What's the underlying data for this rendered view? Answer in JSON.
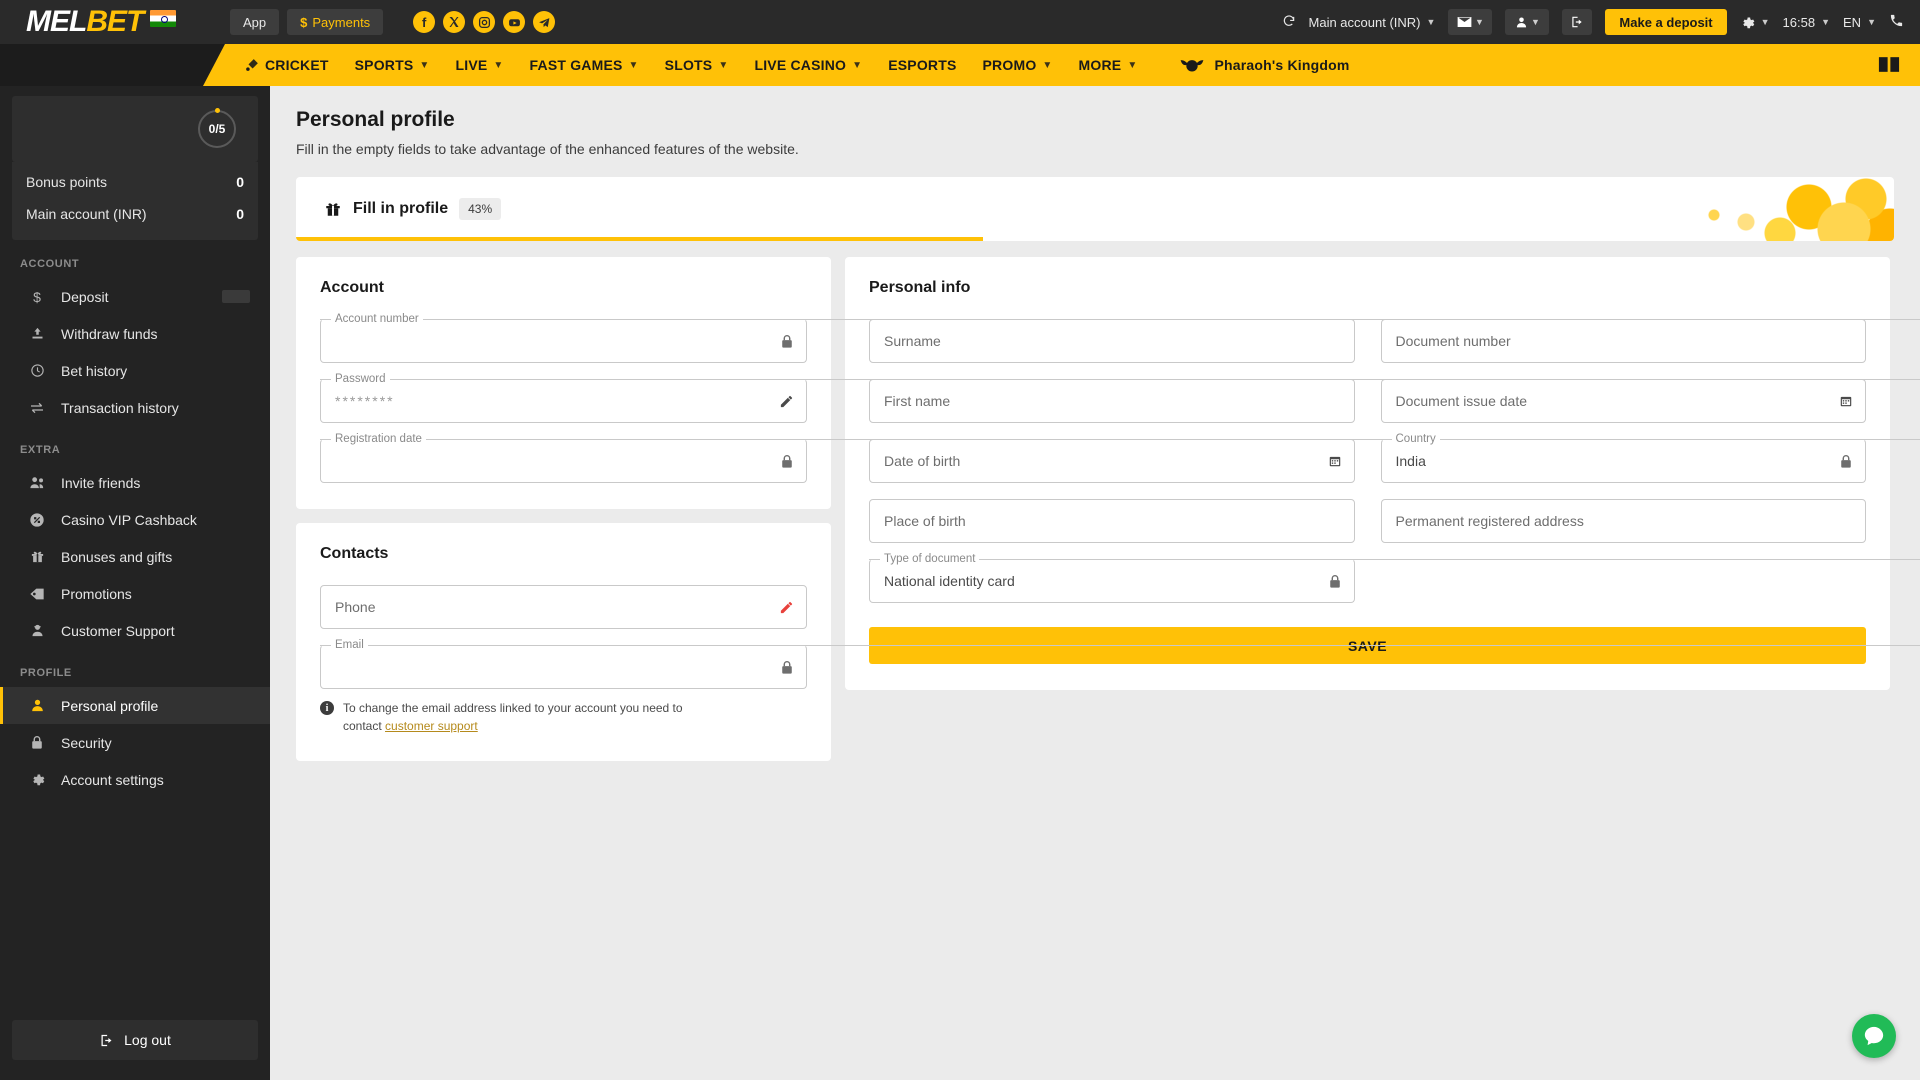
{
  "topbar": {
    "logo": {
      "part1": "MEL",
      "part2": "BET",
      "flag": "india-flag"
    },
    "app_label": "App",
    "payments_label": "Payments",
    "socials": [
      "facebook-icon",
      "x-twitter-icon",
      "instagram-icon",
      "youtube-icon",
      "telegram-icon"
    ],
    "account_label": "Main account (INR)",
    "deposit_label": "Make a deposit",
    "time": "16:58",
    "language": "EN",
    "icons": {
      "refresh": "refresh-icon",
      "mail": "mail-icon",
      "user": "user-icon",
      "logout": "logout-icon",
      "settings": "gear-icon",
      "phone": "phone-icon"
    }
  },
  "nav": {
    "items": [
      {
        "label": "CRICKET",
        "caret": false,
        "icon": "cricket-icon"
      },
      {
        "label": "SPORTS",
        "caret": true
      },
      {
        "label": "LIVE",
        "caret": true
      },
      {
        "label": "FAST GAMES",
        "caret": true
      },
      {
        "label": "SLOTS",
        "caret": true
      },
      {
        "label": "LIVE CASINO",
        "caret": true
      },
      {
        "label": "ESPORTS",
        "caret": false
      },
      {
        "label": "PROMO",
        "caret": true
      },
      {
        "label": "MORE",
        "caret": true
      }
    ],
    "promo": {
      "label": "Pharaoh's Kingdom",
      "icon": "pharaoh-icon"
    },
    "book_icon": "book-icon"
  },
  "sidebar": {
    "ring_value": "0/5",
    "balances": [
      {
        "label": "Bonus points",
        "value": "0"
      },
      {
        "label": "Main account (INR)",
        "value": "0"
      }
    ],
    "sections": [
      {
        "label": "ACCOUNT",
        "items": [
          {
            "label": "Deposit",
            "icon": "dollar-icon",
            "active": false,
            "badge": true
          },
          {
            "label": "Withdraw funds",
            "icon": "withdraw-icon",
            "active": false
          },
          {
            "label": "Bet history",
            "icon": "clock-icon",
            "active": false
          },
          {
            "label": "Transaction history",
            "icon": "transfer-icon",
            "active": false
          }
        ]
      },
      {
        "label": "EXTRA",
        "items": [
          {
            "label": "Invite friends",
            "icon": "people-icon",
            "active": false
          },
          {
            "label": "Casino VIP Cashback",
            "icon": "percent-icon",
            "active": false
          },
          {
            "label": "Bonuses and gifts",
            "icon": "gift-icon",
            "active": false
          },
          {
            "label": "Promotions",
            "icon": "tag-icon",
            "active": false
          },
          {
            "label": "Customer Support",
            "icon": "support-icon",
            "active": false
          }
        ]
      },
      {
        "label": "PROFILE",
        "items": [
          {
            "label": "Personal profile",
            "icon": "person-icon",
            "active": true
          },
          {
            "label": "Security",
            "icon": "lock-icon",
            "active": false
          },
          {
            "label": "Account settings",
            "icon": "gear-icon",
            "active": false
          }
        ]
      }
    ],
    "logout_label": "Log out",
    "logout_icon": "logout-icon"
  },
  "page": {
    "title": "Personal profile",
    "subtitle": "Fill in the empty fields to take advantage of the enhanced features of the website."
  },
  "banner": {
    "icon": "gift-icon",
    "title": "Fill in profile",
    "percent_label": "43%",
    "progress_percent": 43
  },
  "account_card": {
    "title": "Account",
    "fields": [
      {
        "label": "Account number",
        "value": "",
        "type": "floating",
        "icon": "lock-icon"
      },
      {
        "label": "Password",
        "value": "********",
        "type": "floating",
        "icon": "pencil-icon"
      },
      {
        "label": "Registration date",
        "value": "",
        "type": "floating",
        "icon": "lock-icon"
      }
    ]
  },
  "contacts_card": {
    "title": "Contacts",
    "fields": [
      {
        "label": "Phone",
        "value": "",
        "type": "placeholder",
        "icon": "pencil-icon-red"
      },
      {
        "label": "Email",
        "value": "",
        "type": "floating",
        "icon": "lock-icon"
      }
    ],
    "note_text": "To change the email address linked to your account you need to contact ",
    "note_link": "customer support"
  },
  "personal_info": {
    "title": "Personal info",
    "left_fields": [
      {
        "label": "Surname",
        "value": "",
        "type": "placeholder",
        "icon": ""
      },
      {
        "label": "First name",
        "value": "",
        "type": "placeholder",
        "icon": ""
      },
      {
        "label": "Date of birth",
        "value": "",
        "type": "placeholder",
        "icon": "calendar-icon"
      },
      {
        "label": "Place of birth",
        "value": "",
        "type": "placeholder",
        "icon": ""
      },
      {
        "label": "Type of document",
        "value": "National identity card",
        "type": "floating",
        "icon": "lock-icon"
      }
    ],
    "right_fields": [
      {
        "label": "Document number",
        "value": "",
        "type": "placeholder",
        "icon": ""
      },
      {
        "label": "Document issue date",
        "value": "",
        "type": "placeholder",
        "icon": "calendar-icon"
      },
      {
        "label": "Country",
        "value": "India",
        "type": "floating",
        "icon": "lock-icon"
      },
      {
        "label": "Permanent registered address",
        "value": "",
        "type": "placeholder",
        "icon": ""
      }
    ],
    "save_label": "SAVE"
  },
  "chat": {
    "icon": "chat-icon",
    "color": "#21bb57"
  },
  "colors": {
    "accent": "#ffc107",
    "dark": "#2a2a2a",
    "sidebar": "#232323",
    "page_bg": "#ebebeb"
  }
}
